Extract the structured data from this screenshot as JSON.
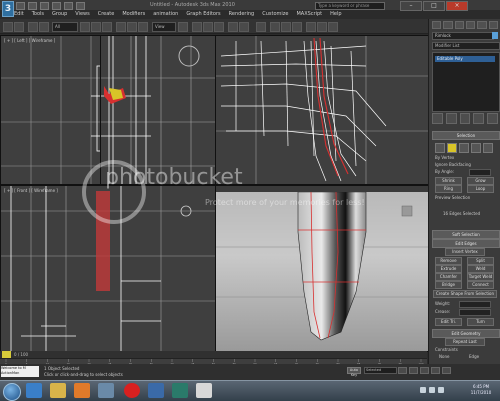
{
  "titlebar": {
    "app_logo": "3",
    "window_title": "Untitled - Autodesk 3ds Max 2010",
    "help_search_placeholder": "Type a keyword or phrase",
    "controls": [
      "–",
      "□",
      "×"
    ]
  },
  "menubar": [
    "Edit",
    "Tools",
    "Group",
    "Views",
    "Create",
    "Modifiers",
    "animation",
    "Graph Editors",
    "Rendering",
    "Customize",
    "MAXScript",
    "Help"
  ],
  "toolbar": {
    "selection_filter": "All",
    "view_dropdown": "View"
  },
  "viewports": {
    "top_left_label": "[ + ] [ Left ] [ Wireframe ]",
    "bottom_left_label": "[ + ] [ Front ] [ Wireframe ]",
    "perspective_label": "[ + ] [ Perspective ] [ Smooth + Highlights ]"
  },
  "command_panel": {
    "object_name": "Rimlock",
    "object_color": "#5aa0d8",
    "modifier_list": "Modifier List",
    "stack_item": "Editable Poly",
    "selection_rollout": "Selection",
    "by_vertex": "By Vertex",
    "ignore_backfacing": "Ignore Backfacing",
    "by_angle": "By Angle:",
    "shrink": "Shrink",
    "grow": "Grow",
    "ring": "Ring",
    "loop": "Loop",
    "preview_selection": "Preview Selection",
    "selected_info": "16 Edges Selected",
    "soft_selection_rollout": "Soft Selection",
    "edit_edges_rollout": "Edit Edges",
    "insert_vertex": "Insert Vertex",
    "remove": "Remove",
    "split": "Split",
    "extrude": "Extrude",
    "weld": "Weld",
    "chamfer": "Chamfer",
    "target_weld": "Target Weld",
    "bridge": "Bridge",
    "connect": "Connect",
    "create_shape": "Create Shape From Selection",
    "weight": "Weight:",
    "crease": "Crease:",
    "edit_tri": "Edit Tri.",
    "turn": "Turn",
    "edit_geometry_rollout": "Edit Geometry",
    "repeat_last": "Repeat Last",
    "constraints": "Constraints",
    "none": "None",
    "edge": "Edge"
  },
  "timeline": {
    "frame_counter": "0 / 100",
    "ticks": [
      "0",
      "5",
      "10",
      "15",
      "20",
      "25",
      "30",
      "35",
      "40",
      "45",
      "50",
      "55",
      "60",
      "65",
      "70",
      "75",
      "80",
      "85",
      "90",
      "95",
      "100"
    ]
  },
  "statusbar": {
    "maxscript_line1": "Welcome to M",
    "maxscript_line2": "ActionMan",
    "status_line1": "1 Object Selected",
    "status_line2": "Click or click-and-drag to select objects",
    "auto_key": "Auto Key",
    "selected": "Selected"
  },
  "taskbar": {
    "time": "6:45 PM",
    "date": "11/7/2010"
  },
  "watermark": {
    "text": "photobucket",
    "sub": "Protect more of your memories for less!"
  },
  "colors": {
    "selection_red": "#d83030",
    "selection_yellow": "#d8c428"
  }
}
